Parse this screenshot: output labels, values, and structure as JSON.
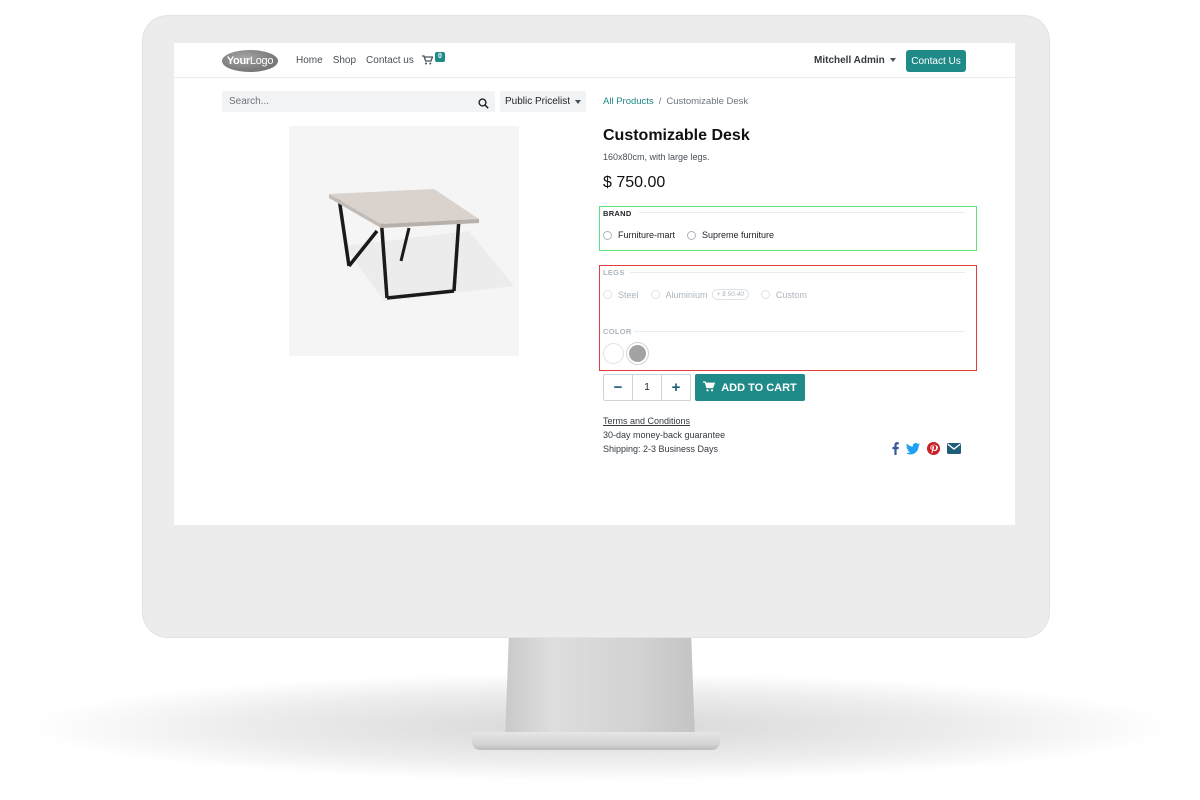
{
  "header": {
    "logo_part1": "Your",
    "logo_part2": "Logo",
    "nav": [
      "Home",
      "Shop",
      "Contact us"
    ],
    "cart_count": "0",
    "user": "Mitchell Admin",
    "contact_button": "Contact Us"
  },
  "search": {
    "placeholder": "Search..."
  },
  "pricelist": "Public Pricelist",
  "breadcrumb": {
    "parent": "All Products",
    "separator": "/",
    "current": "Customizable Desk"
  },
  "product": {
    "title": "Customizable Desk",
    "description": "160x80cm, with large legs.",
    "price": "$ 750.00"
  },
  "attributes": {
    "brand": {
      "label": "BRAND",
      "options": [
        "Furniture-mart",
        "Supreme furniture"
      ]
    },
    "legs": {
      "label": "LEGS",
      "options": [
        "Steel",
        "Aluminium",
        "Custom"
      ],
      "extra_price": "+ $ 50.40"
    },
    "color": {
      "label": "COLOR",
      "swatches": [
        "#ffffff",
        "#a3a3a3"
      ]
    }
  },
  "quantity": {
    "value": "1",
    "minus": "−",
    "plus": "+"
  },
  "add_to_cart": "ADD TO CART",
  "info": {
    "terms": "Terms and Conditions",
    "guarantee": "30-day money-back guarantee",
    "shipping": "Shipping: 2-3 Business Days"
  },
  "colors": {
    "accent": "#1f8a87",
    "brand_highlight": "#5ee07a",
    "legs_highlight": "#e0403d"
  },
  "share_icons": [
    "facebook-icon",
    "twitter-icon",
    "pinterest-icon",
    "envelope-icon"
  ]
}
